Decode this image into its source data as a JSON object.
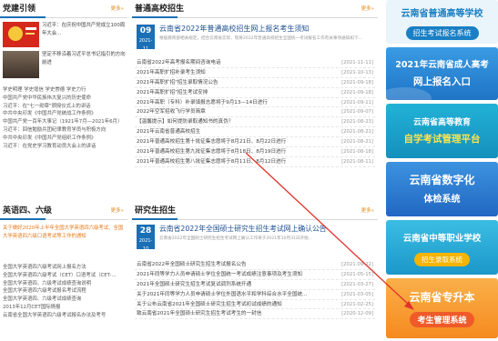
{
  "left_top": {
    "title": "党建引领",
    "more": "更多»",
    "feature1": "习近平：在庆祝中国共产党成立100周年大会...",
    "feature2": "坚定不移沿着习近平总书记指引的方向前进",
    "items": [
      "学史明理 学史增信 学史崇德 学史力行",
      "中国共产党中华民族伟大复兴的历史使命",
      "习近平：在\"七一勋章\"颁授仪式上的讲话",
      "中共中央印发《中国共产党统战工作条例》",
      "中国共产党一百年大事记（1921年7月—2021年6月）",
      "习近平：回信勉励兵团纪律教育学员与积极方向",
      "中共中央印发《中国共产党组织工作条例》",
      "习近平：在党史学习教育动员大会上的讲话"
    ]
  },
  "left_bottom": {
    "title": "英语四、六级",
    "more": "更多»",
    "highlight": "关于做好2020年上半年全国大学英语四六级考试、全国大学英语四六级口语考试等工作的通知",
    "items": [
      "全国大学英语四六级考试网上报名方法",
      "全国大学英语四六级考试（CET）口语考试（CET-...",
      "全国大学英语四、六级考试成绩查询说明",
      "全国大学英语四六级考试报名考试流程",
      "全国大学英语四、六级考试成绩查询",
      "2013年12月CET国际情报",
      "云南省全国大学英语四六级考试报名办法及考号"
    ]
  },
  "mid_top": {
    "title": "普通高校招生",
    "more": "更多»",
    "date": {
      "day": "09",
      "ym": "2021-11"
    },
    "headline": "云南省2022年普通高校招生网上报名考生须知",
    "summary": "根据教育部相关规定，结合云南省实际，现将2022年普通高校招生全国统一考试报名工作有关事项通知如下...",
    "rows": [
      {
        "t": "云南省2022年高考报名期间咨询电话",
        "d": "[2021-11-11]"
      },
      {
        "t": "2021年高职扩招补录考生须知",
        "d": "[2021-10-13]"
      },
      {
        "t": "2021年高职扩招\"招生录取情况公告",
        "d": "[2021-09-18]"
      },
      {
        "t": "2021年高职扩招\"招生考试安排",
        "d": "[2021-09-18]"
      },
      {
        "t": "2021年高职（专科）补录填报志愿将于9月13—14日进行",
        "d": "[2021-09-11]"
      },
      {
        "t": "2022年空军招收飞行学员简章",
        "d": "[2021-09-07]"
      },
      {
        "t": "【温馨提示】如何提防录取通知书的真伪？",
        "d": "[2021-08-23]"
      },
      {
        "t": "2021年云南省普通高校招生",
        "d": "[2021-08-21]"
      },
      {
        "t": "2021年普通高校招生第十批征集志愿将于8月21日、8月22日进行",
        "d": "[2021-08-21]"
      },
      {
        "t": "2021年普通高校招生第九批征集志愿将于8月18日、8月19日进行",
        "d": "[2021-08-18]"
      },
      {
        "t": "2021年普通高校招生第八批征集志愿将于8月11日、8月12日进行",
        "d": "[2021-08-11]"
      }
    ]
  },
  "mid_bottom": {
    "title": "研究生招生",
    "more": "更多»",
    "date": {
      "day": "28",
      "ym": "2021-10"
    },
    "headline": "云南省2022年全国硕士研究生招生考试网上确认公告",
    "summary": "云南省2022年全国硕士研究生招生考试网上确认工作将于2021年10月31日开始...",
    "rows": [
      {
        "t": "云南省2022年全国硕士研究生招生考试报名公告",
        "d": "[2021-09-22]"
      },
      {
        "t": "2021年同等学力人员申请硕士学位全国统一考试成绩注意事项及考生须知",
        "d": "[2021-05-15]"
      },
      {
        "t": "2021年全国硕士研究生招生考试复试调剂系统开通",
        "d": "[2021-03-27]"
      },
      {
        "t": "关于2021年同等学力人员申请硕士学位外国语水平和学科综合水平全国统...",
        "d": "[2021-03-05]"
      },
      {
        "t": "关于公布云南省2021年全国硕士研究生招生考试初试成绩的通知",
        "d": "[2021-02-25]"
      },
      {
        "t": "致云南省2021年全国硕士研究生招生考试考生的一封信",
        "d": "[2020-12-09]"
      }
    ]
  },
  "banners": [
    {
      "line1": "云南省普通高等学校",
      "line2": "招生考试报名系统",
      "bg": "#eaf4fb",
      "c1": "#1a7fc4",
      "c2bg": "#1a7fc4",
      "c2": "#ffffff"
    },
    {
      "line1": "2021年云南省成人高考",
      "line2": "网上报名入口",
      "bg": "#2f8fd8",
      "c1": "#ffffff",
      "c2bg": "#2f8fd8",
      "c2": "#ffffff"
    },
    {
      "line1": "云南省高等教育",
      "line2": "自学考试管理平台",
      "bg": "#17a2c8",
      "c1": "#ffffff",
      "c2bg": "#17a2c8",
      "c2": "#ffe44d"
    },
    {
      "line1": "云南省数字化",
      "line2": "体检系统",
      "bg": "#2d83d6",
      "c1": "#ffffff",
      "c2bg": "#2d83d6",
      "c2": "#ffffff"
    },
    {
      "line1": "云南省中等职业学校",
      "line2": "招生录取系统",
      "bg": "#2caed8",
      "c1": "#ffffff",
      "c2bg": "#f4b400",
      "c2": "#ffffff"
    },
    {
      "line1": "云南省专升本",
      "line2": "考生管理系统",
      "bg": "#f79a2b",
      "c1": "#ffffff",
      "c2bg": "#f05a28",
      "c2": "#ffffff"
    }
  ]
}
